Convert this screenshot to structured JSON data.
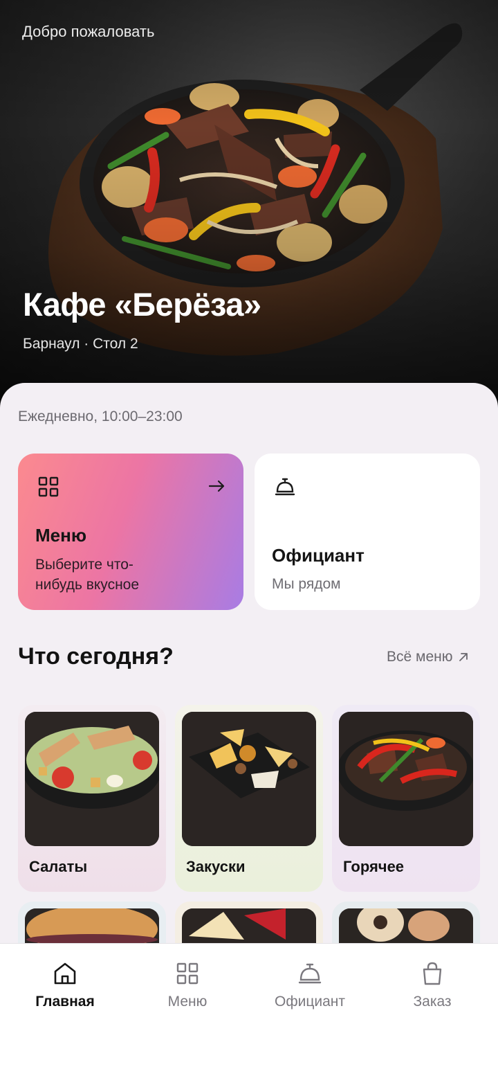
{
  "hero": {
    "welcome": "Добро пожаловать",
    "title": "Кафе «Берёза»",
    "subtitle": "Барнаул · Стол 2"
  },
  "info": {
    "hours": "Ежедневно, 10:00–23:00"
  },
  "cards": {
    "menu": {
      "title": "Меню",
      "description": "Выберите что-нибудь вкусное",
      "icon": "grid-icon",
      "arrow": "arrow-right-icon"
    },
    "waiter": {
      "title": "Официант",
      "description": "Мы рядом",
      "icon": "bell-icon"
    }
  },
  "section": {
    "title": "Что сегодня?",
    "link": "Всё меню",
    "link_icon": "arrow-up-right-icon"
  },
  "categories": [
    {
      "name": "Салаты",
      "tint": "#f1dfe9"
    },
    {
      "name": "Закуски",
      "tint": "#eef2de"
    },
    {
      "name": "Горячее",
      "tint": "#ece3f3"
    },
    {
      "name": "",
      "tint": "#e7eef2"
    },
    {
      "name": "",
      "tint": "#f5eee2"
    },
    {
      "name": "",
      "tint": "#e6ecef"
    }
  ],
  "nav": [
    {
      "label": "Главная",
      "icon": "home-icon",
      "active": true
    },
    {
      "label": "Меню",
      "icon": "grid-icon",
      "active": false
    },
    {
      "label": "Официант",
      "icon": "bell-icon",
      "active": false
    },
    {
      "label": "Заказ",
      "icon": "bag-icon",
      "active": false
    }
  ],
  "colors": {
    "menu_card_gradient": [
      "#fb8a8f",
      "#ec75a4",
      "#a87ce4"
    ],
    "background": "#f3eff4"
  }
}
